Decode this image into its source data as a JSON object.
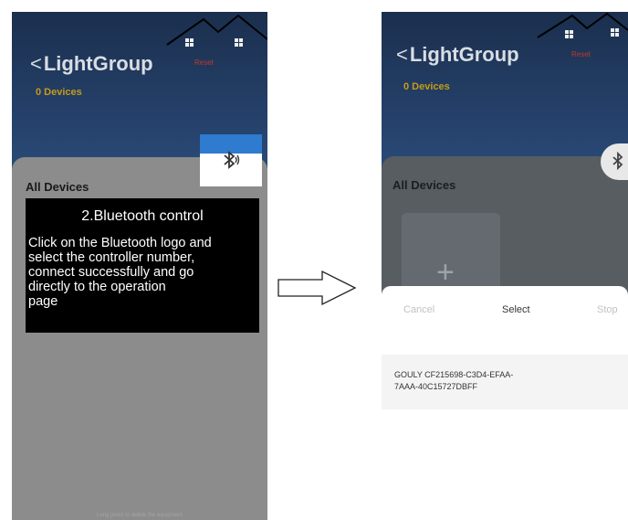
{
  "left_phone": {
    "header": {
      "back_chevron": "<",
      "title": "LightGroup",
      "device_count": "0 Devices",
      "reset_label": "Reset"
    },
    "panel_title": "All Devices",
    "bluetooth_icon": "bluetooth-icon",
    "callout": {
      "heading": "2.Bluetooth control",
      "body": "Click on the Bluetooth logo and\n select the controller number,\nconnect successfully and go\n directly to the operation\npage"
    },
    "bottom_hint": "Long press to delete the equipment"
  },
  "right_phone": {
    "header": {
      "back_chevron": "<",
      "title": "LightGroup",
      "device_count": "0 Devices",
      "reset_label": "Reset"
    },
    "panel_title": "All Devices",
    "add_symbol": "+",
    "sheet": {
      "cancel_label": "Cancel",
      "select_label": "Select",
      "stop_label": "Stop",
      "device_entry": "GOULY CF215698-C3D4-EFAA-\n7AAA-40C15727DBFF"
    }
  },
  "colors": {
    "header_dark": "#1b2f4e",
    "panel_gray": "#8c8c8c",
    "accent_blue": "#2e7bd0",
    "count_gold": "#c59b1a",
    "reset_red": "#c0392b"
  }
}
